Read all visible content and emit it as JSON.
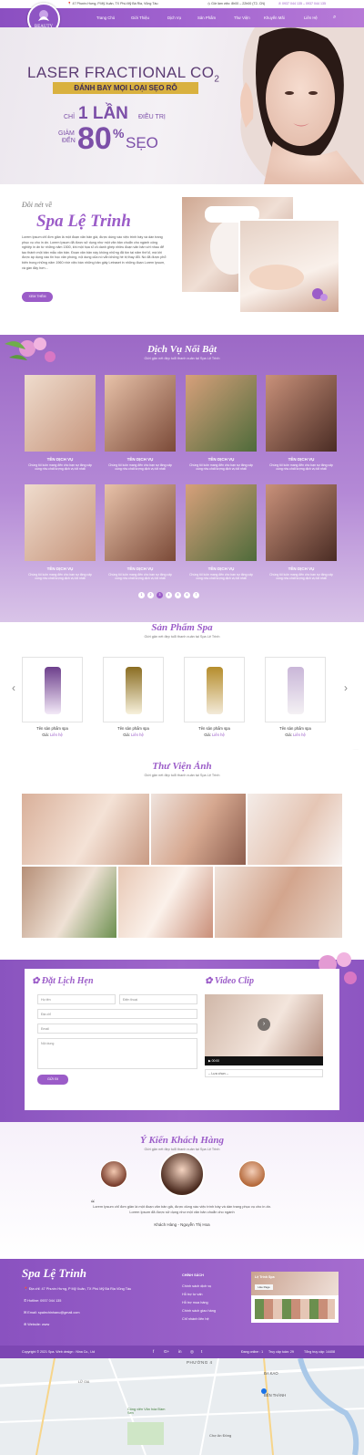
{
  "topbar": {
    "address": "47 Phước Hưng, P.Mỹ Xuân, TX Phú Mỹ Bà Ria, Vũng Tàu",
    "hours": "Giờ làm việc: 8h00 – 22h00 (T2- CN)",
    "phones": "0937 044 135 – 0937 044 135"
  },
  "logo": {
    "text": "BEAUTY"
  },
  "nav": {
    "items": [
      "Trang Chủ",
      "Giới Thiệu",
      "Dịch Vụ",
      "Sản Phẩm",
      "Thư Viện",
      "Khuyến Mãi",
      "Liên Hệ"
    ]
  },
  "hero": {
    "line1": "LASER FRACTIONAL CO",
    "line1_sub": "2",
    "ribbon": "ĐÁNH BAY MỌI LOẠI SẸO RỖ",
    "chi": "CHỈ",
    "lan": "1 LẦN",
    "dieutri": "ĐIỀU TRỊ",
    "giam": "GIẢM",
    "den": "ĐẾN",
    "pct": "80",
    "pct_sign": "%",
    "seo": "SẸO"
  },
  "about": {
    "script_top": "Đôi nét về",
    "title": "Spa Lệ Trinh",
    "body": "Lorem Ipsum chỉ đơn giản là một đoạn văn bản giả, được dùng vào việc trình bày và dàn trang phục vụ cho in ấn. Lorem Ipsum đã được sử dụng như một văn bản chuẩn cho ngành công nghiệp in ấn từ những năm 1500, khi một họa sĩ vô danh ghép nhiều đoạn văn bản với nhau để tạo thành một bản mẫu văn bản. Đoạn văn bản này không những đã tồn tại năm thế kỉ, mà khi được áp dụng vào tin học văn phòng, nội dung của nó vẫn không hề bị thay đổi. Nó đã được phổ biến trong những năm 1960 nhờ việc bán những bản giấy Letraset in những đoạn Lorem Ipsum, và gần đây hơn...",
    "button": "XEM THÊM"
  },
  "services": {
    "title": "Dịch Vụ Nổi Bật",
    "subtitle": "Giới gặn nét đẹp tuổi thanh xuân tại Spa Lệ Trinh",
    "card_title": "TÊN DỊCH VỤ",
    "card_desc": "Chúng tôi luôn mang đến cho bạn sự tăng cấp cùng nhu chất lượng dịch vụ tốt nhất",
    "pages": [
      "1",
      "2",
      "3",
      "4",
      "5",
      "6",
      "7"
    ]
  },
  "products": {
    "title": "Sản Phẩm Spa",
    "subtitle": "Giới gặn nét đẹp tuổi thanh xuân tại Spa Lệ Trinh",
    "name": "Tên sản phẩm spa",
    "price_label": "Giá:",
    "price_value": "Liên hệ",
    "prev": "‹",
    "next": "›"
  },
  "gallery": {
    "title": "Thư Viện Ảnh",
    "subtitle": "Giới gặn nét đẹp tuổi thanh xuân tại Spa Lệ Trinh"
  },
  "booking": {
    "title": "Đặt Lịch Hẹn",
    "name_ph": "Họ tên",
    "phone_ph": "Điện thoại",
    "address_ph": "Địa chỉ",
    "email_ph": "Email",
    "content_ph": "Nội dung",
    "submit": "GỬI ĐI",
    "video_title": "Video Clip",
    "video_time": "00:00",
    "video_select": "-- Lựa chọn --"
  },
  "testimonials": {
    "title": "Ý Kiến Khách Hàng",
    "subtitle": "Giới gặn nét đẹp tuổi thanh xuân tại Spa Lệ Trinh",
    "quote": "Lorem Ipsum chỉ đơn giản là một đoạn văn bản giả, được dùng vào việc trình bày và dàn trang phục vụ cho in ấn. Lorem Ipsum đã được sử dụng như một văn bản chuẩn cho ngành",
    "author": "Khách Hàng - Nguyễn Thị Hoa"
  },
  "footer": {
    "brand": "Spa Lệ Trinh",
    "address": "Địa chỉ: 47 Phước Hưng, P Mỹ Xuân, TX Phú Mỹ Bà Rịa Vũng Tàu",
    "hotline": "Hotline: 0937 044 135",
    "email": "Email: spalechinhanu@gmail.com",
    "website": "Website: www",
    "policy_title": "CHÍNH SÁCH",
    "policies": [
      "Chính sách dịch vụ",
      "Hỗ trợ tư vấn",
      "Hỗ trợ mua hàng",
      "Chính sách giao hàng",
      "Chỉ nhánh liên hệ"
    ],
    "fb_name": "Lệ Trinh Spa",
    "fb_like": "Like Page"
  },
  "copyright": {
    "text": "Copyright © 2021 Spa. Web design : Nina Co., Ltd",
    "online": "Đang online : 1",
    "week": "Truy cập tuần: 29",
    "total": "Tổng truy cập: 14408"
  },
  "map": {
    "labels": [
      "PHƯỜNG 4",
      "ĐA KAO",
      "BẾN THÀNH",
      "Công viên Văn hóa Đầm Sen",
      "Chợ An Đông",
      "LỮ GIA"
    ]
  },
  "colors": {
    "primary": "#9b5cc8",
    "dark": "#7d47b3",
    "accent": "#c28fe3"
  }
}
